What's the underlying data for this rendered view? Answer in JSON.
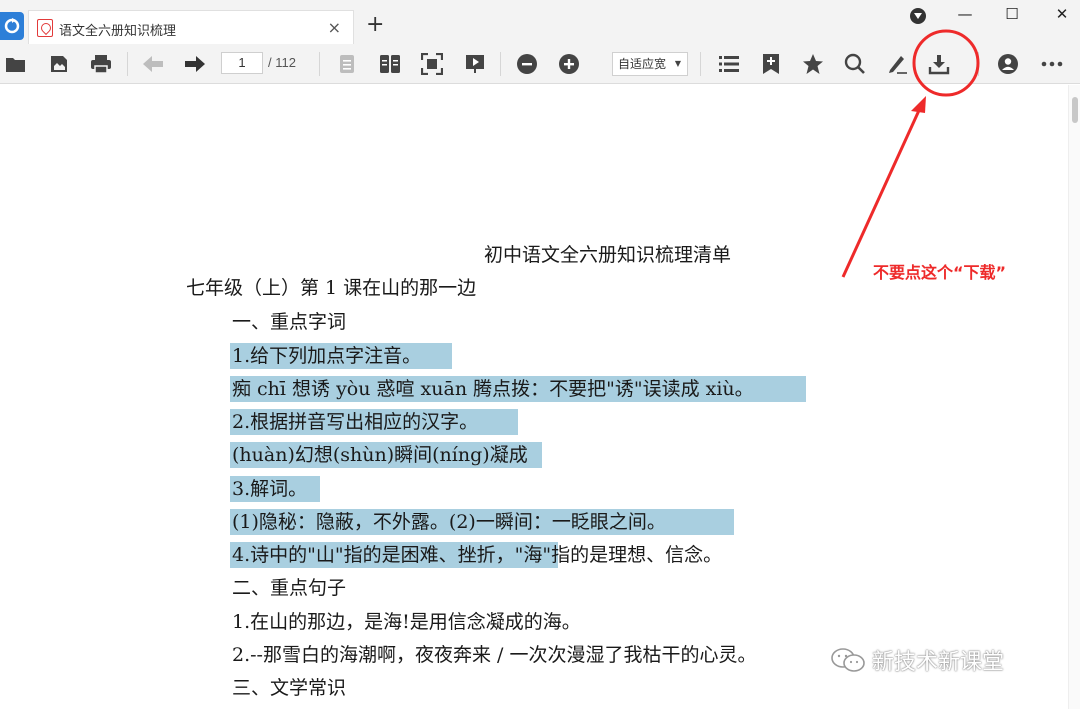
{
  "tab": {
    "title": "语文全六册知识梳理",
    "close": "×"
  },
  "new_tab": "+",
  "window": {
    "minimize": "—",
    "maximize": "☐",
    "close": "✕"
  },
  "toolbar": {
    "page_current": "1",
    "page_total": "/ 112",
    "zoom": "自适应宽",
    "icons": [
      "open-folder-icon",
      "save-icon",
      "print-icon",
      "back-arrow-icon",
      "forward-arrow-icon",
      "single-page-icon",
      "two-page-icon",
      "fit-page-icon",
      "presentation-icon",
      "zoom-out-icon",
      "zoom-in-icon",
      "outline-list-icon",
      "bookmark-add-icon",
      "star-icon",
      "search-icon",
      "pen-icon",
      "download-icon",
      "account-icon",
      "more-icon"
    ]
  },
  "document": {
    "title": "初中语文全六册知识梳理清单",
    "lines": [
      "七年级（上）第 1 课在山的那一边",
      "一、重点字词",
      "1.给下列加点字注音。",
      "痴 chī 想诱 yòu 惑喧 xuān 腾点拨：不要把\"诱\"误读成 xiù。",
      "2.根据拼音写出相应的汉字。",
      "(huàn)幻想(shùn)瞬间(níng)凝成",
      "3.解词。",
      "(1)隐秘：隐蔽，不外露。(2)一瞬间：一眨眼之间。",
      "4.诗中的\"山\"指的是困难、挫折，\"海\"指的是理想、信念。",
      "二、重点句子",
      "1.在山的那边，是海!是用信念凝成的海。",
      "2.--那雪白的海潮啊，夜夜奔来 / 一次次漫湿了我枯干的心灵。",
      "三、文学常识"
    ]
  },
  "annotation": {
    "text": "不要点这个“下载”",
    "color": "#ee2a2a"
  },
  "watermark": "新技术新课堂",
  "colors": {
    "highlight": "#a9cfe0",
    "toolbar_bg": "#f3f3f3",
    "app_blue": "#2d7fd8"
  }
}
